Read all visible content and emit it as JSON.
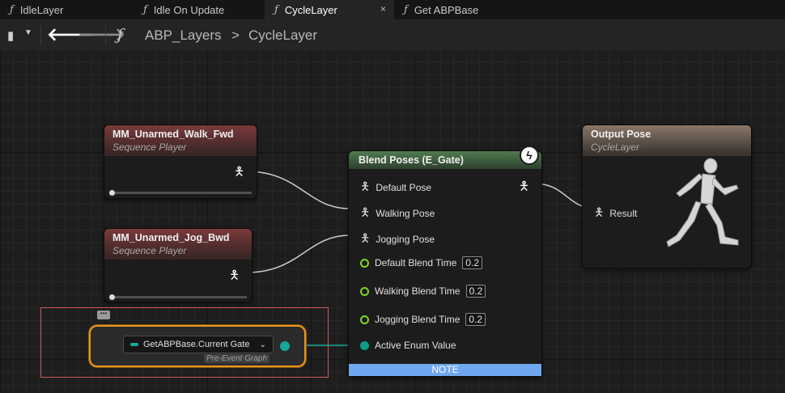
{
  "tabs": [
    {
      "label": "IdleLayer",
      "icon": "function-icon",
      "active": false
    },
    {
      "label": "Idle On Update",
      "icon": "function-icon",
      "active": false
    },
    {
      "label": "CycleLayer",
      "icon": "function-icon",
      "active": true,
      "close": "×"
    },
    {
      "label": "Get ABPBase",
      "icon": "function-icon",
      "active": false
    }
  ],
  "toolbar": {
    "fn_glyph": "ƒ",
    "breadcrumb": [
      "ABP_Layers",
      "CycleLayer"
    ],
    "separator": ">"
  },
  "nodes": {
    "walk": {
      "title": "MM_Unarmed_Walk_Fwd",
      "subtitle": "Sequence Player"
    },
    "jog": {
      "title": "MM_Unarmed_Jog_Bwd",
      "subtitle": "Sequence Player"
    },
    "blend": {
      "title": "Blend Poses (E_Gate)",
      "default_pose": "Default Pose",
      "walking_pose": "Walking Pose",
      "jogging_pose": "Jogging Pose",
      "default_blend": "Default Blend Time",
      "default_blend_value": "0.2",
      "walking_blend": "Walking Blend Time",
      "walking_blend_value": "0.2",
      "jogging_blend": "Jogging Blend Time",
      "jogging_blend_value": "0.2",
      "active_enum": "Active Enum Value",
      "note": "NOTE"
    },
    "output": {
      "title": "Output Pose",
      "subtitle": "CycleLayer",
      "result": "Result"
    },
    "gate": {
      "label": "GetABPBase.Current Gate",
      "context": "Pre-Event Graph"
    }
  },
  "colors": {
    "exec_green": "#7fd323",
    "enum_teal": "#15a899",
    "selection_orange": "#e8951e",
    "note_blue": "#6fa8f0"
  }
}
